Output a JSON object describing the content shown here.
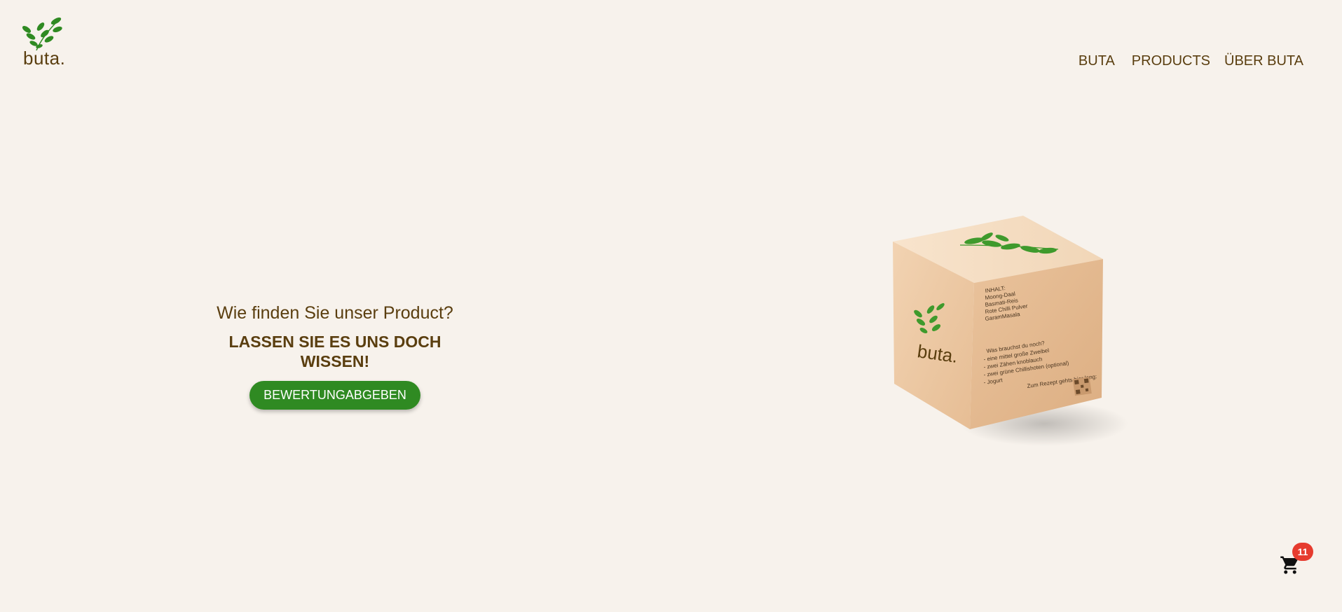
{
  "brand": {
    "name": "buta.",
    "leaf_color": "#2f8a22",
    "text_color": "#5a3e0f"
  },
  "nav": {
    "items": [
      {
        "label": "BUTA"
      },
      {
        "label": "PRODUCTS"
      },
      {
        "label": "ÜBER BUTA"
      }
    ]
  },
  "hero": {
    "question": "Wie finden Sie unser Product?",
    "cta_text": "LASSEN SIE ES UNS DOCH WISSEN!",
    "button_label": "BEWERTUNGABGEBEN",
    "button_color": "#2f8a22"
  },
  "product_box": {
    "brand": "buta.",
    "contents_title": "INHALT:",
    "contents": [
      "Moong-Daal",
      "Basmati-Reis",
      "Rote Chilli Pulver",
      "GaramMasala"
    ],
    "needs_title": "Was brauchst du noch?",
    "needs": [
      "- eine mittel große Zweibel",
      "- zwei Zähen knoblauch",
      "- zwei grüne Chillishoten (optional)",
      "- Jogurt"
    ],
    "recipe_text": "Zum Rezept gehts hier lang:"
  },
  "cart": {
    "icon": "cart-icon",
    "count": "11",
    "badge_color": "#e63b2e"
  },
  "background": "#f7f2ec"
}
